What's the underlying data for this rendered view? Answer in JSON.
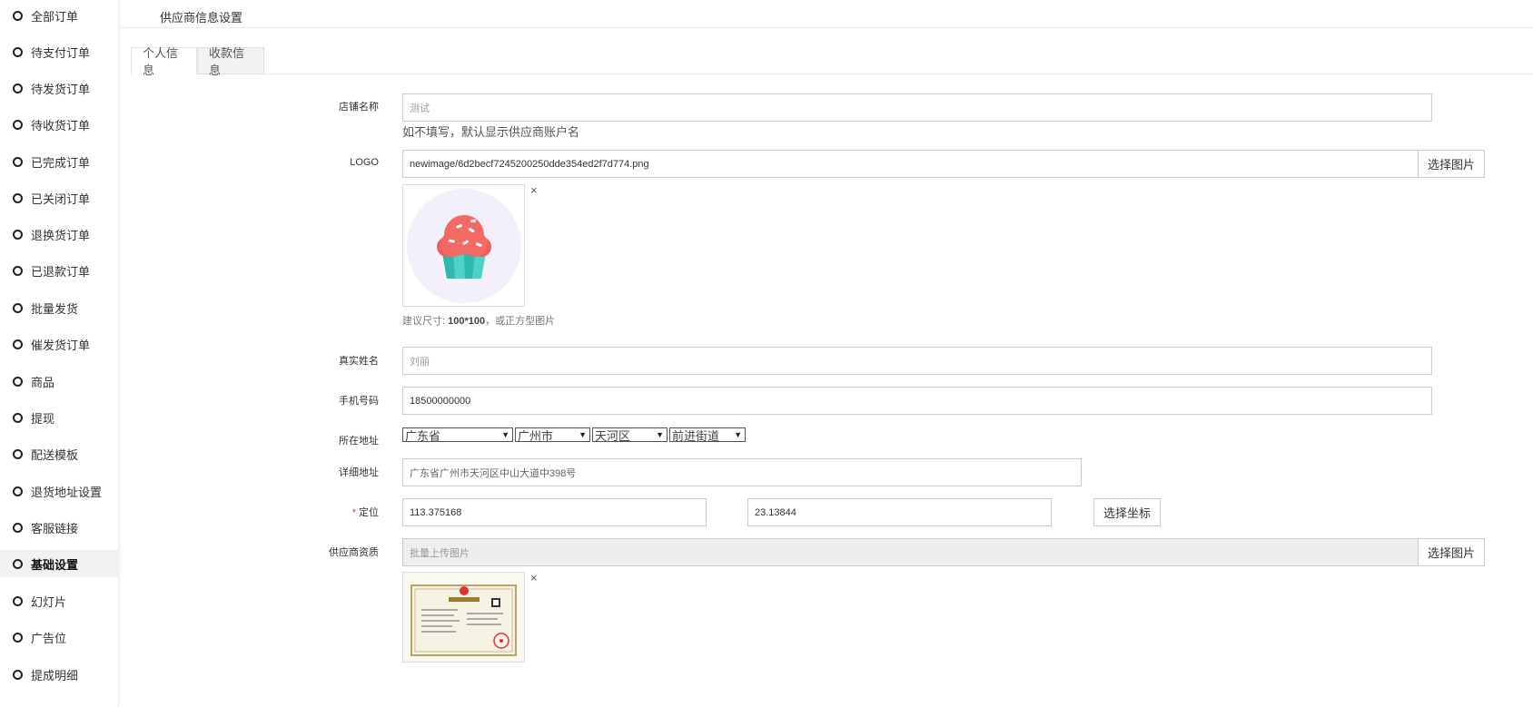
{
  "sidebar": {
    "items": [
      {
        "label": "全部订单",
        "active": false
      },
      {
        "label": "待支付订单",
        "active": false
      },
      {
        "label": "待发货订单",
        "active": false
      },
      {
        "label": "待收货订单",
        "active": false
      },
      {
        "label": "已完成订单",
        "active": false
      },
      {
        "label": "已关闭订单",
        "active": false
      },
      {
        "label": "退换货订单",
        "active": false
      },
      {
        "label": "已退款订单",
        "active": false
      },
      {
        "label": "批量发货",
        "active": false
      },
      {
        "label": "催发货订单",
        "active": false
      },
      {
        "label": "商品",
        "active": false
      },
      {
        "label": "提现",
        "active": false
      },
      {
        "label": "配送模板",
        "active": false
      },
      {
        "label": "退货地址设置",
        "active": false
      },
      {
        "label": "客服链接",
        "active": false
      },
      {
        "label": "基础设置",
        "active": true
      },
      {
        "label": "幻灯片",
        "active": false
      },
      {
        "label": "广告位",
        "active": false
      },
      {
        "label": "提成明细",
        "active": false
      }
    ]
  },
  "header": {
    "title": "供应商信息设置"
  },
  "tabs": [
    {
      "label": "个人信息",
      "active": true
    },
    {
      "label": "收款信息",
      "active": false
    }
  ],
  "form": {
    "shop_name": {
      "label": "店铺名称",
      "placeholder": "测试",
      "help": "如不填写，默认显示供应商账户名"
    },
    "logo": {
      "label": "LOGO",
      "value": "newimage/6d2becf7245200250dde354ed2f7d774.png",
      "button": "选择图片",
      "remove": "×",
      "hint_prefix": "建议尺寸: ",
      "hint_size": "100*100",
      "hint_suffix": "，或正方型图片"
    },
    "real_name": {
      "label": "真实姓名",
      "placeholder": "刘丽"
    },
    "phone": {
      "label": "手机号码",
      "value": "18500000000"
    },
    "address": {
      "label": "所在地址",
      "province": "广东省",
      "city": "广州市",
      "district": "天河区",
      "street": "前进街道"
    },
    "detail_address": {
      "label": "详细地址",
      "value": "广东省广州市天河区中山大道中398号"
    },
    "location": {
      "label": "定位",
      "required_mark": "*",
      "lng": "113.375168",
      "lat": "23.13844",
      "button": "选择坐标"
    },
    "qualification": {
      "label": "供应商资质",
      "placeholder": "批量上传图片",
      "button": "选择图片",
      "remove": "×"
    }
  },
  "colors": {
    "accent_border": "#cccccc",
    "active_bg": "#f1f1f1",
    "required": "#ee3333"
  }
}
